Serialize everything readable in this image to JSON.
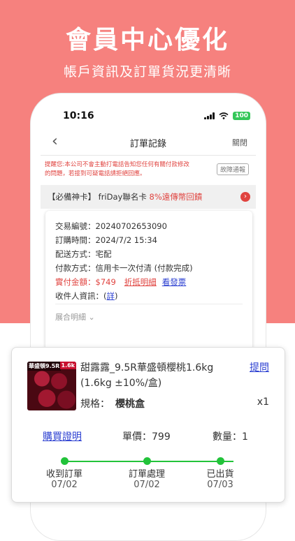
{
  "promo": {
    "headline": "會員中心優化",
    "subline": "帳戶資訊及訂單貨況更清晰"
  },
  "status_bar": {
    "time": "10:16",
    "battery": "100"
  },
  "nav": {
    "back": "‹",
    "title": "訂單記錄",
    "close": "關閉"
  },
  "notice": {
    "text": "提醒您:本公司不會主動打電話告知您任何有關付款修改的問題，若接到可疑電話請拒絕回應。",
    "report_button": "故障通報"
  },
  "card_banner": {
    "prefix": "【必備神卡】 friDay聯名卡 ",
    "highlight": "8%遠傳幣回饋"
  },
  "order": {
    "id_label": "交易編號：",
    "id": "20240702653090",
    "time_label": "訂購時間：",
    "time": "2024/7/2 15:34",
    "delivery_label": "配送方式：",
    "delivery": "宅配",
    "payment_label": "付款方式：",
    "payment": "信用卡一次付清 (付款完成)",
    "amount_label": "實付金額：",
    "amount": "$749",
    "discount_link": "折抵明細",
    "invoice_link": "看發票",
    "recipient_label": "收件人資訊：",
    "recipient_open": "(",
    "recipient_link": "詳",
    "recipient_close": ")",
    "expand": "展合明細"
  },
  "product": {
    "thumb_label": "華盛頓9.5R",
    "thumb_size": "1.6k",
    "name": "甜露露_9.5R華盛頓櫻桃1.6kg (1.6kg ±10%/盒)",
    "ask": "提問",
    "spec_label": "規格：",
    "spec": "櫻桃盒",
    "qty_x": "x1",
    "receipt": "購買證明",
    "unit_price": "單價：799",
    "quantity": "數量：1"
  },
  "progress": {
    "color": "#22c33a",
    "steps": [
      {
        "label": "收到訂單",
        "date": "07/02"
      },
      {
        "label": "訂單處理",
        "date": "07/02"
      },
      {
        "label": "已出貨",
        "date": "07/03"
      }
    ]
  }
}
